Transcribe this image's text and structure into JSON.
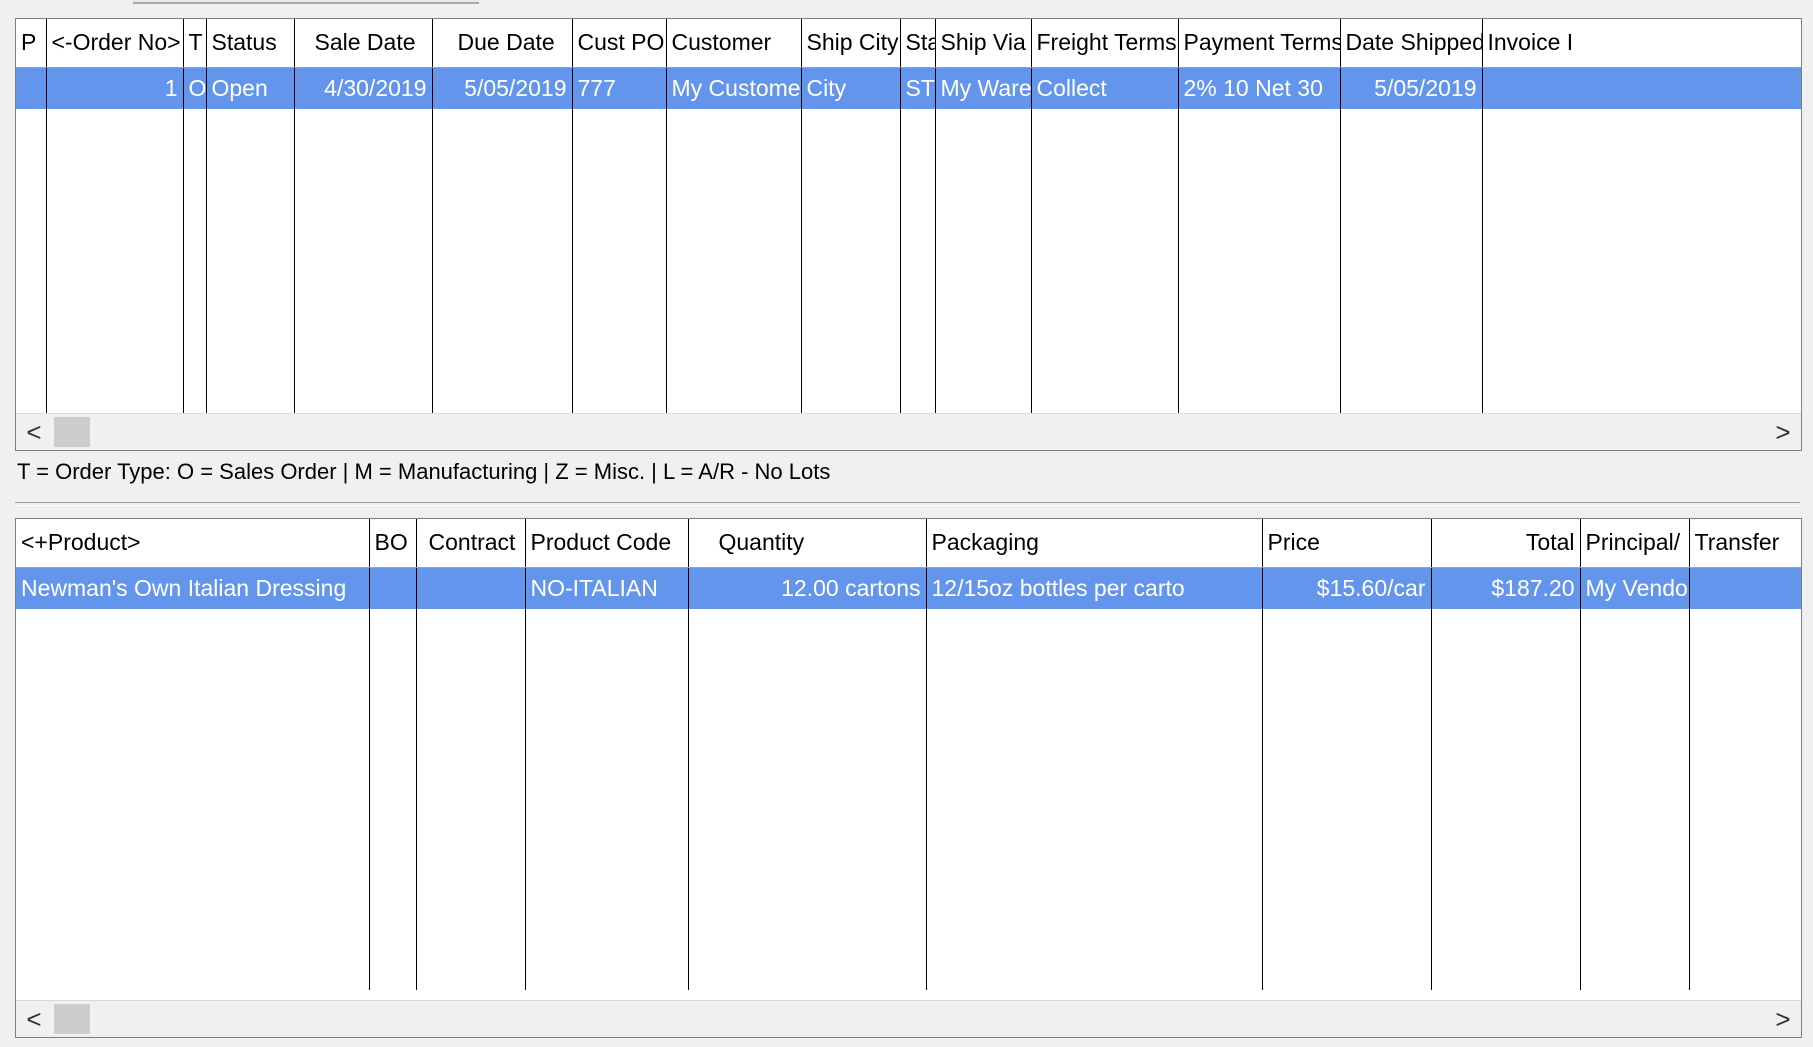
{
  "orders_grid": {
    "headers": [
      "P",
      "<-Order No>",
      "T",
      "Status",
      "Sale Date",
      "Due Date",
      "Cust PO",
      "Customer",
      "Ship City",
      "Sta",
      "Ship Via",
      "Freight Terms",
      "Payment Terms",
      "Date Shipped",
      "Invoice I"
    ],
    "rows": [
      [
        "",
        "1",
        "O",
        "Open",
        "4/30/2019",
        "5/05/2019",
        "777",
        "My Customer",
        "City",
        "ST",
        "My Warel",
        "Collect",
        "2% 10 Net 30",
        "5/05/2019",
        ""
      ]
    ]
  },
  "legend_text": "T = Order Type: O = Sales Order | M = Manufacturing | Z = Misc. | L = A/R - No Lots",
  "lines_grid": {
    "headers": [
      "<+Product>",
      "BO",
      "Contract",
      "Product Code",
      "Quantity",
      "Packaging",
      "Price",
      "Total",
      "Principal/",
      "Transfer"
    ],
    "rows": [
      [
        "Newman's Own Italian Dressing",
        "",
        "",
        "NO-ITALIAN",
        "12.00 cartons",
        "12/15oz bottles per carto",
        "$15.60/car",
        "$187.20",
        "My Vendo",
        ""
      ]
    ]
  },
  "scrollbar": {
    "left_arrow": "<",
    "right_arrow": ">"
  },
  "colors": {
    "selection": "#6495ed",
    "grid_lines": "#000000",
    "background": "#f0f0f0"
  }
}
